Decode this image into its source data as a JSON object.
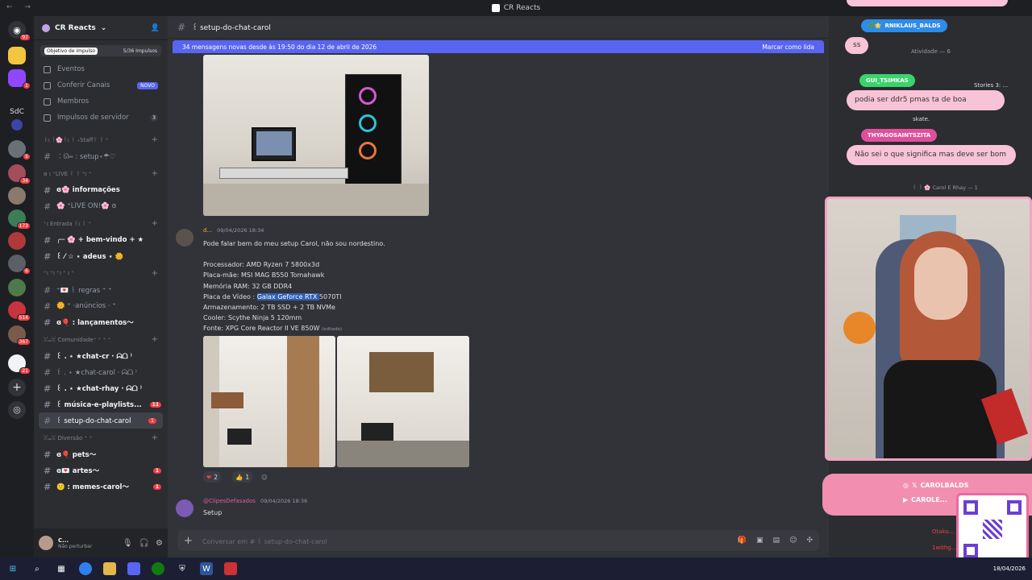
{
  "window": {
    "title": "CR Reacts"
  },
  "server": {
    "name": "CR Reacts",
    "boost_label": "Objetivo de impulso",
    "boost_progress": "5/36 Impulsos",
    "menu": [
      {
        "label": "Eventos"
      },
      {
        "label": "Conferir Canais",
        "badge": "NOVO"
      },
      {
        "label": "Membros"
      },
      {
        "label": "Impulsos de servidor",
        "count": "3"
      }
    ]
  },
  "guild_rail": {
    "sdc_label": "SdC",
    "badges": [
      "97",
      "1",
      "5",
      "34",
      "173",
      "6",
      "514",
      "367",
      "21"
    ]
  },
  "channels": [
    {
      "type": "cat",
      "label": "꒰⦂ ꒱🌸꒰⦂ ꒱ ₊Staff꒰ ꒱ ⁺"
    },
    {
      "type": "ch",
      "label": "︰ᘏ⑅ : setup⋆☂︎♡"
    },
    {
      "type": "cat",
      "label": "ɞ ⦂ ⁺LIVE ꒰ ꒱ ⁺⦂ ⁺"
    },
    {
      "type": "ch",
      "label": "ɞ🌸 informações",
      "bold": true
    },
    {
      "type": "ch",
      "label": "🌸 ⁺LIVE ON!🌸 ɞ"
    },
    {
      "type": "cat",
      "label": "⁺⦂ Entrada ꒰⦂ ꒱ ⁺"
    },
    {
      "type": "ch",
      "label": "╭─ 🌸 + bem-vindo + ★",
      "bold": true
    },
    {
      "type": "ch",
      "label": "꒰ ⁄ ☆ ⋆ adeus ⋆ 🌼",
      "bold": true
    },
    {
      "type": "cat",
      "label": "⁺⦂ ⁺⦂ ⁺⦂ ⁺ ⦂ ⁺"
    },
    {
      "type": "ch",
      "label": "⁺💌 ꒰ regras ⁺ ⁺"
    },
    {
      "type": "ch",
      "label": "🌼 ⁺ ·anúncios · ⁺"
    },
    {
      "type": "ch",
      "label": "ɞ🎈 : lançamentos〜",
      "bold": true
    },
    {
      "type": "cat",
      "label": "ꈍᴗꈍ Comunidade⁺ ⁺ ⁺ ⁺"
    },
    {
      "type": "ch",
      "label": "꒰ . ⋆ ★chat-cr · ᗣᗝ ⁾",
      "bold": true
    },
    {
      "type": "ch",
      "label": "꒰ . ⋆ ★chat-carol · ᗣᗝ ⁾"
    },
    {
      "type": "ch",
      "label": "꒰ . ⋆ ★chat-rhay · ᗣᗝ ⁾",
      "bold": true
    },
    {
      "type": "ch",
      "label": "꒰ música-e-playlists...",
      "bold": true,
      "unread": "11"
    },
    {
      "type": "ch",
      "label": "꒰ setup-do-chat-carol",
      "selected": true,
      "unread": "1"
    },
    {
      "type": "cat",
      "label": "ꈍᴗꈍ Diversão ⁺ ⁺"
    },
    {
      "type": "ch",
      "label": "ɞ🎈 pets〜",
      "bold": true
    },
    {
      "type": "ch",
      "label": "ɞ💌 artes〜",
      "bold": true,
      "unread": "1"
    },
    {
      "type": "ch",
      "label": "🙂 : memes-carol〜",
      "bold": true,
      "unread": "1"
    }
  ],
  "user": {
    "name": "C...",
    "status": "Não perturbar"
  },
  "channel_header": {
    "name": "꒰ setup-do-chat-carol"
  },
  "banner": {
    "text": "34 mensagens novas desde às 19:50 do dia 12 de abril de 2026",
    "action": "Marcar como lida"
  },
  "message1": {
    "author": "d...",
    "timestamp": "09/04/2026 18:34",
    "intro": "Pode falar bem do meu setup Carol, não sou nordestino.",
    "lines": [
      "Processador: AMD Ryzen 7 5800x3d",
      "Placa-mãe: MSI MAG B550 Tomahawk",
      "Memória RAM: 32 GB DDR4"
    ],
    "gpu_prefix": "Placa de Vídeo : ",
    "gpu_highlight": "Galax Geforce RTX ",
    "gpu_rest": "5070TI",
    "lines2": [
      "Armazenamento: 2 TB SSD  + 2 TB NVMe",
      "Cooler:  Scythe Ninja 5 120mm"
    ],
    "psu": "Fonte: XPG Core Reactor II VE 850W",
    "edited": "(editado)",
    "reactions": [
      {
        "emoji": "❤",
        "count": "2"
      },
      {
        "emoji": "👍",
        "count": "1"
      }
    ]
  },
  "message2": {
    "author": "@ClipesDefasados",
    "timestamp": "09/04/2026 18:36",
    "text": "Setup"
  },
  "input": {
    "placeholder": "Conversar em # ꒰ setup-do-chat-carol"
  },
  "overlay": {
    "top_name": "RNIKLAUS_BALDS",
    "bubble_ss": "ss",
    "activity": "Atividade — 6",
    "name2": "GUI_TSIMKAS",
    "msg2": "podia ser ddr5 pmas ta de boa",
    "name3": "THYAGOSAINTSZITA",
    "msg3": "Não sei o que significa mas deve ser bom",
    "side1": "Stories 3: ...",
    "side2": "skate.",
    "side3": "꒰ ꒱ 🌸 Carol E Rhay — 1",
    "social1": "CAROLBALDS",
    "social2": "CAROLE...",
    "side4": "Otaku...",
    "side5": "1withg..."
  },
  "taskbar": {
    "date": "18/04/2026"
  }
}
